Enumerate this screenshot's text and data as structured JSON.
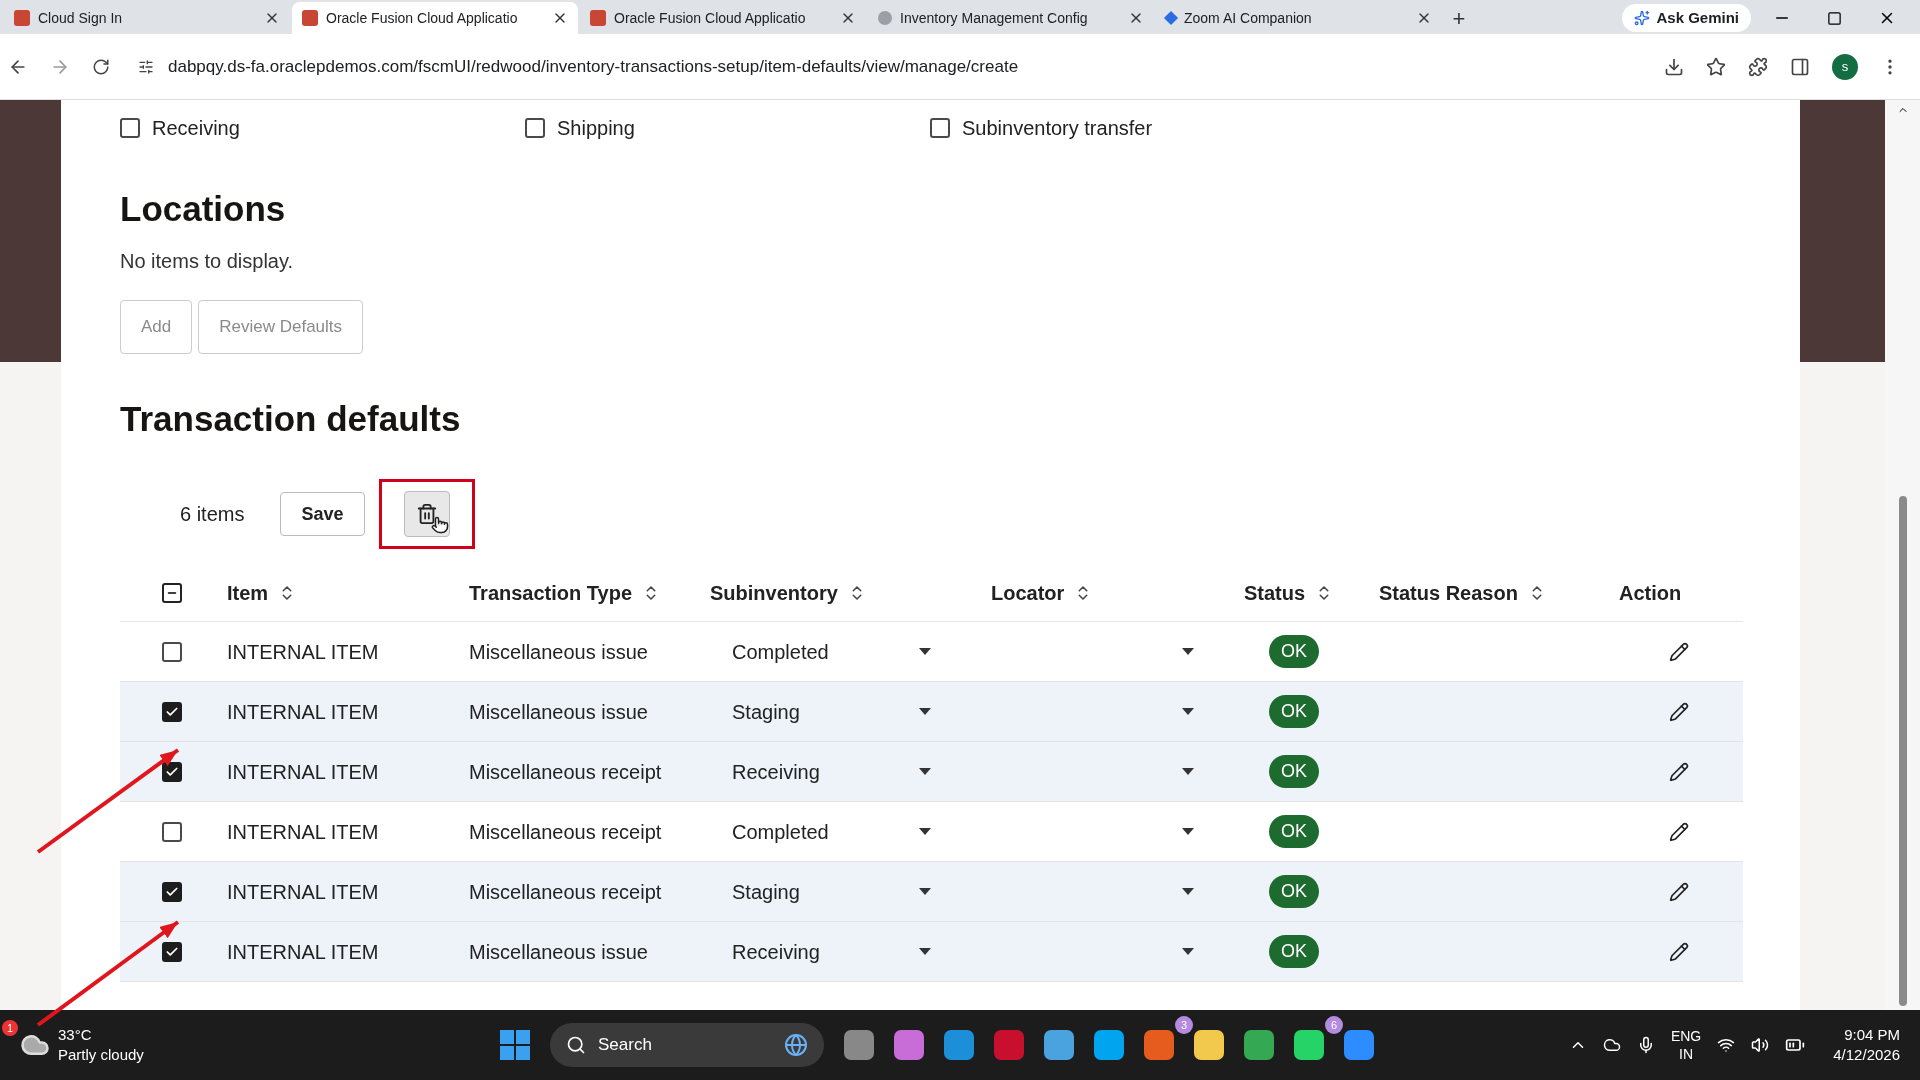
{
  "browser": {
    "tabs": [
      {
        "title": "Cloud Sign In",
        "selected": false
      },
      {
        "title": "Oracle Fusion Cloud Applicatio",
        "selected": true
      },
      {
        "title": "Oracle Fusion Cloud Applicatio",
        "selected": false
      },
      {
        "title": "Inventory Management Config",
        "selected": false
      },
      {
        "title": "Zoom AI Companion",
        "selected": false
      }
    ],
    "new_tab": "+",
    "gemini": "Ask Gemini",
    "url": "dabpqy.ds-fa.oraclepdemos.com/fscmUI/redwood/inventory-transactions-setup/item-defaults/view/manage/create",
    "profile": "s"
  },
  "filters": [
    {
      "label": "Receiving",
      "checked": false
    },
    {
      "label": "Shipping",
      "checked": false
    },
    {
      "label": "Subinventory transfer",
      "checked": false
    }
  ],
  "locations": {
    "title": "Locations",
    "empty": "No items to display.",
    "buttons": [
      "Add",
      "Review Defaults"
    ]
  },
  "transaction_defaults": {
    "title": "Transaction defaults",
    "count": "6 items",
    "save": "Save",
    "select_all": {
      "indeterminate": true
    },
    "columns": [
      "Item",
      "Transaction Type",
      "Subinventory",
      "Locator",
      "Status",
      "Status Reason",
      "Action"
    ],
    "rows": [
      {
        "item": "INTERNAL ITEM",
        "type": "Miscellaneous issue",
        "subinventory": "Completed",
        "status": "OK",
        "checked": false
      },
      {
        "item": "INTERNAL ITEM",
        "type": "Miscellaneous issue",
        "subinventory": "Staging",
        "status": "OK",
        "checked": true
      },
      {
        "item": "INTERNAL ITEM",
        "type": "Miscellaneous receipt",
        "subinventory": "Receiving",
        "status": "OK",
        "checked": true
      },
      {
        "item": "INTERNAL ITEM",
        "type": "Miscellaneous receipt",
        "subinventory": "Completed",
        "status": "OK",
        "checked": false
      },
      {
        "item": "INTERNAL ITEM",
        "type": "Miscellaneous receipt",
        "subinventory": "Staging",
        "status": "OK",
        "checked": true
      },
      {
        "item": "INTERNAL ITEM",
        "type": "Miscellaneous issue",
        "subinventory": "Receiving",
        "status": "OK",
        "checked": true
      }
    ]
  },
  "taskbar": {
    "weather_badge": "1",
    "temperature": "33°C",
    "weather": "Partly cloudy",
    "search": "Search",
    "badges": [
      "3",
      "6"
    ],
    "language": "ENG",
    "region": "IN",
    "time": "9:04 PM",
    "date": "4/12/2026"
  }
}
